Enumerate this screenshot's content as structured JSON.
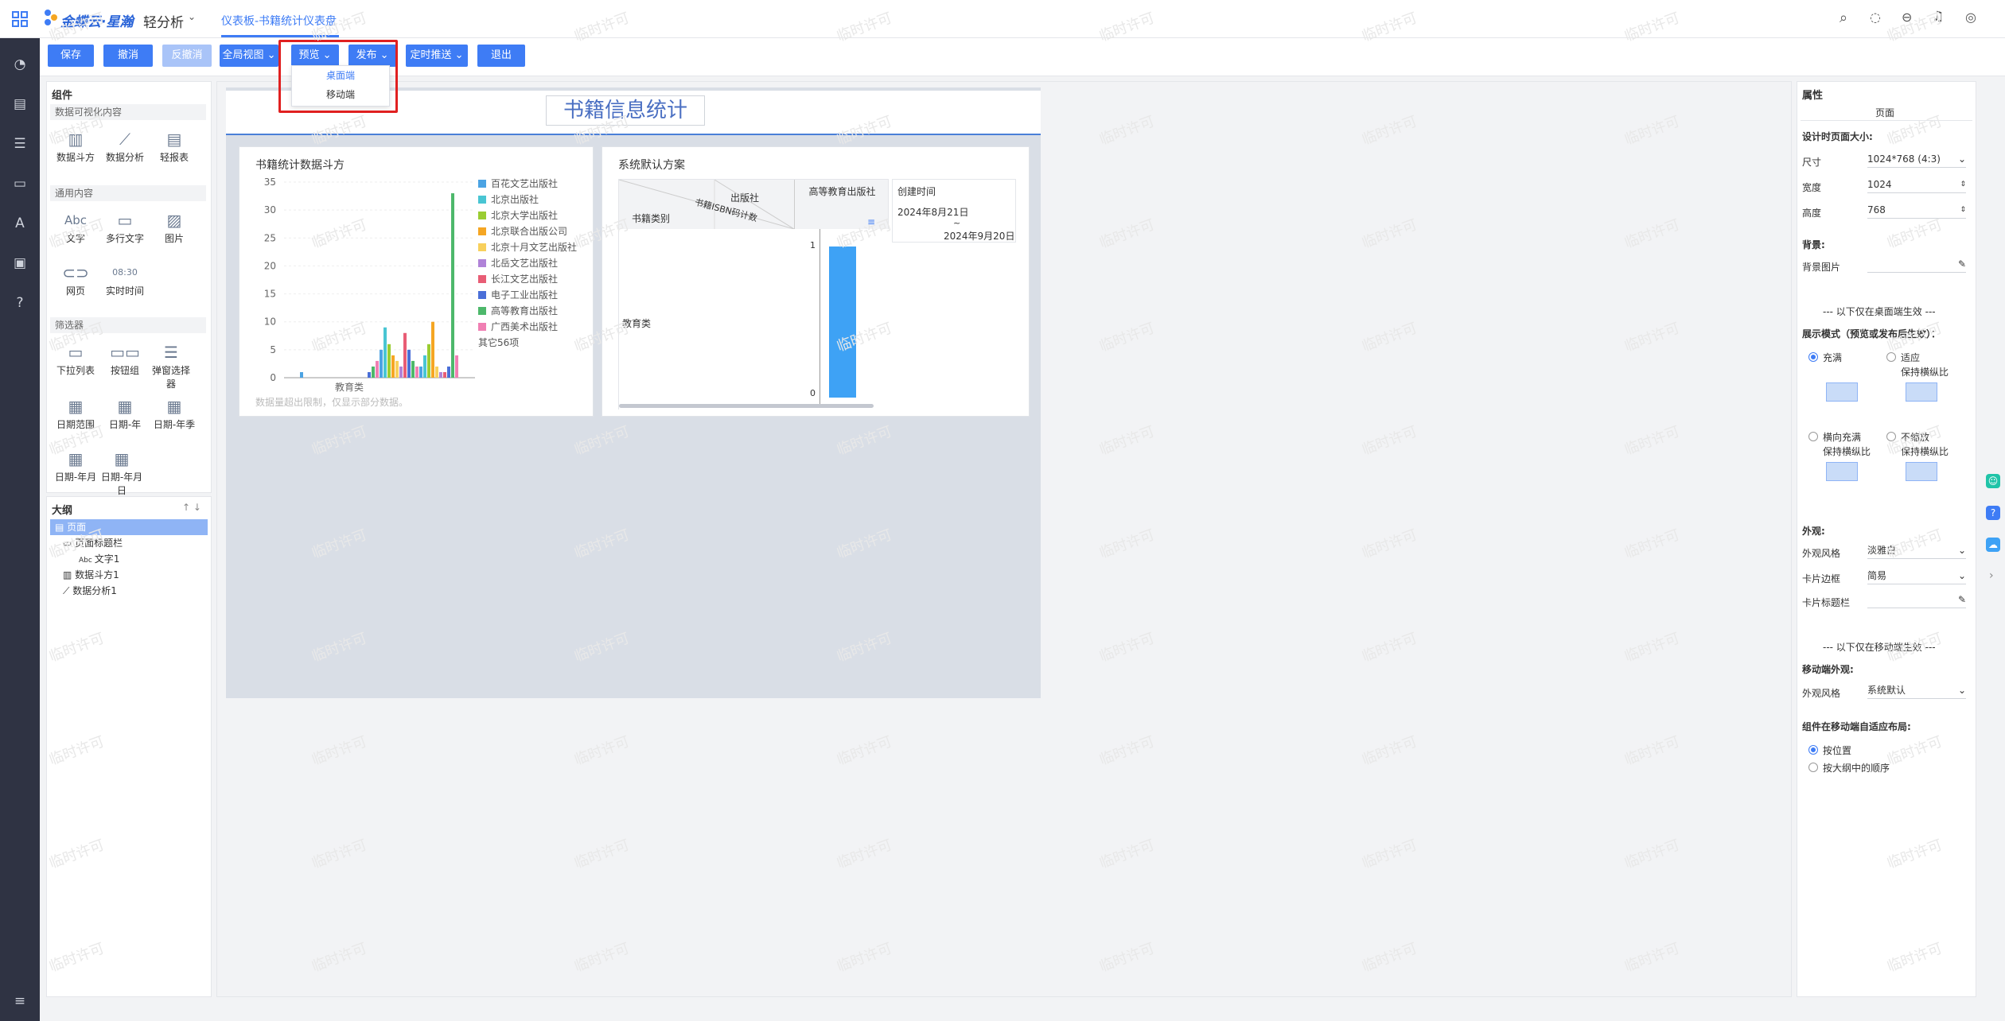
{
  "app": {
    "brand": "金蝶云·星瀚",
    "module": "轻分析",
    "tab": "仪表板-书籍统计仪表盘"
  },
  "toolbar": {
    "save": "保存",
    "undo": "撤消",
    "redo": "反撤消",
    "global_view": "全局视图",
    "preview": "预览",
    "publish": "发布",
    "schedule": "定时推送",
    "exit": "退出"
  },
  "preview_menu": [
    "桌面端",
    "移动端"
  ],
  "components": {
    "title": "组件",
    "sections": [
      "数据可视化内容",
      "通用内容",
      "筛选器"
    ],
    "viz": [
      "数据斗方",
      "数据分析",
      "轻报表"
    ],
    "general": [
      "文字",
      "多行文字",
      "图片",
      "网页",
      "实时时间"
    ],
    "general_glyphs": [
      "Abc",
      "08:30"
    ],
    "filters": [
      "下拉列表",
      "按钮组",
      "弹窗选择器",
      "日期范围",
      "日期-年",
      "日期-年季",
      "日期-年月",
      "日期-年月日"
    ]
  },
  "outline": {
    "title": "大纲",
    "items": [
      "页面",
      "页面标题栏",
      "文字1",
      "数据斗方1",
      "数据分析1"
    ]
  },
  "page_title": "书籍信息统计",
  "card1": {
    "title": "书籍统计数据斗方",
    "footer": "数据量超出限制，仅显示部分数据。"
  },
  "chart_data": {
    "type": "bar",
    "categories": [
      "教育类"
    ],
    "yticks": [
      35,
      30,
      25,
      20,
      15,
      10,
      5,
      0
    ],
    "ylim": [
      0,
      35
    ],
    "series": [
      {
        "name": "百花文艺出版社",
        "color": "#4ba3e3"
      },
      {
        "name": "北京出版社",
        "color": "#49c5d3"
      },
      {
        "name": "北京大学出版社",
        "color": "#9acd32"
      },
      {
        "name": "北京联合出版公司",
        "color": "#f5a623"
      },
      {
        "name": "北京十月文艺出版社",
        "color": "#f8d05c"
      },
      {
        "name": "北岳文艺出版社",
        "color": "#b083d8"
      },
      {
        "name": "长江文艺出版社",
        "color": "#e85d75"
      },
      {
        "name": "电子工业出版社",
        "color": "#4a6fd8"
      },
      {
        "name": "高等教育出版社",
        "color": "#4db86b"
      },
      {
        "name": "广西美术出版社",
        "color": "#f07fb3"
      }
    ],
    "legend_more": "其它56项",
    "values": [
      1,
      0,
      0,
      0,
      0,
      0,
      0,
      0,
      0,
      0,
      0,
      0,
      0,
      0,
      0,
      0,
      0,
      1,
      2,
      3,
      5,
      9,
      6,
      4,
      3,
      2,
      8,
      5,
      3,
      2,
      2,
      4,
      6,
      10,
      2,
      1,
      1,
      2,
      33,
      4
    ]
  },
  "card2": {
    "title": "系统默认方案",
    "col_publisher": "出版社",
    "col_isbn": "书籍ISBN码计数",
    "col_category": "书籍类别",
    "col_value": "高等教育出版社",
    "row": "教育类",
    "axis_max": "1",
    "axis_min": "0"
  },
  "date_filter": {
    "label": "创建时间",
    "from": "2024年8月21日",
    "sep": "~",
    "to": "2024年9月20日"
  },
  "props": {
    "title": "属性",
    "tab": "页面",
    "design_size": "设计时页面大小:",
    "size_label": "尺寸",
    "size_value": "1024*768 (4:3)",
    "width_label": "宽度",
    "width_value": "1024",
    "height_label": "高度",
    "height_value": "768",
    "bg": "背景:",
    "bg_img": "背景图片",
    "desktop_only": "--- 以下仅在桌面端生效 ---",
    "display_mode": "展示模式（预览或发布后生效）：",
    "fill": "充满",
    "fit": "适应",
    "keep_ratio": "保持横纵比",
    "hfill": "横向充满",
    "noscale": "不缩放",
    "appearance": "外观:",
    "style_label": "外观风格",
    "style_value": "淡雅白",
    "border_label": "卡片边框",
    "border_value": "简易",
    "card_title": "卡片标题栏",
    "mobile_only": "--- 以下仅在移动端生效 ---",
    "mobile_appearance": "移动端外观:",
    "m_style_value": "系统默认",
    "adaptive": "组件在移动端自适应布局:",
    "by_position": "按位置",
    "by_outline": "按大纲中的顺序"
  },
  "watermark": "临时许可"
}
